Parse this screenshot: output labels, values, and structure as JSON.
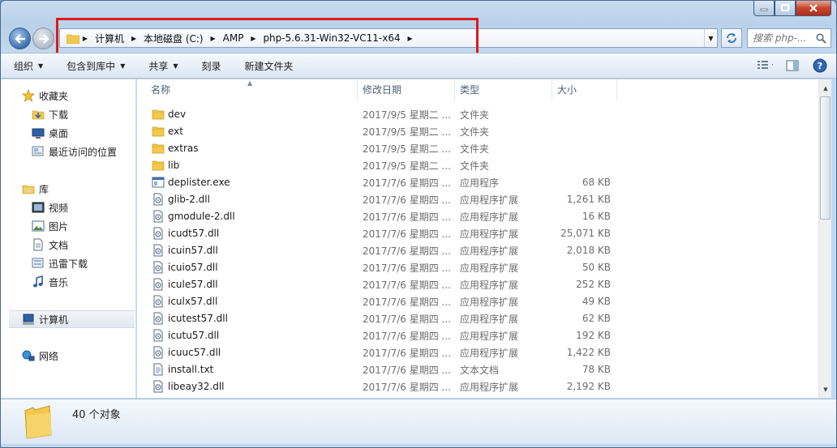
{
  "window": {
    "caption_buttons": [
      "minimize",
      "maximize",
      "close"
    ]
  },
  "address": {
    "breadcrumbs": [
      "计算机",
      "本地磁盘 (C:)",
      "AMP",
      "php-5.6.31-Win32-VC11-x64"
    ],
    "search_placeholder": "搜索 php-..."
  },
  "toolbar": {
    "organize": "组织",
    "include_in_library": "包含到库中",
    "share": "共享",
    "burn": "刻录",
    "new_folder": "新建文件夹"
  },
  "nav": {
    "favorites_label": "收藏夹",
    "favorites": [
      "下载",
      "桌面",
      "最近访问的位置"
    ],
    "libraries_label": "库",
    "libraries": [
      "视频",
      "图片",
      "文档",
      "迅雷下载",
      "音乐"
    ],
    "computer_label": "计算机",
    "network_label": "网络"
  },
  "columns": {
    "name": "名称",
    "date": "修改日期",
    "type": "类型",
    "size": "大小"
  },
  "files": [
    {
      "name": "dev",
      "date": "2017/9/5 星期二 ...",
      "type": "文件夹",
      "size": "",
      "icon": "folder-icon"
    },
    {
      "name": "ext",
      "date": "2017/9/5 星期二 ...",
      "type": "文件夹",
      "size": "",
      "icon": "folder-icon"
    },
    {
      "name": "extras",
      "date": "2017/9/5 星期二 ...",
      "type": "文件夹",
      "size": "",
      "icon": "folder-icon"
    },
    {
      "name": "lib",
      "date": "2017/9/5 星期二 ...",
      "type": "文件夹",
      "size": "",
      "icon": "folder-icon"
    },
    {
      "name": "deplister.exe",
      "date": "2017/7/6 星期四 ...",
      "type": "应用程序",
      "size": "68 KB",
      "icon": "exe-icon"
    },
    {
      "name": "glib-2.dll",
      "date": "2017/7/6 星期四 ...",
      "type": "应用程序扩展",
      "size": "1,261 KB",
      "icon": "dll-icon"
    },
    {
      "name": "gmodule-2.dll",
      "date": "2017/7/6 星期四 ...",
      "type": "应用程序扩展",
      "size": "16 KB",
      "icon": "dll-icon"
    },
    {
      "name": "icudt57.dll",
      "date": "2017/7/6 星期四 ...",
      "type": "应用程序扩展",
      "size": "25,071 KB",
      "icon": "dll-icon"
    },
    {
      "name": "icuin57.dll",
      "date": "2017/7/6 星期四 ...",
      "type": "应用程序扩展",
      "size": "2,018 KB",
      "icon": "dll-icon"
    },
    {
      "name": "icuio57.dll",
      "date": "2017/7/6 星期四 ...",
      "type": "应用程序扩展",
      "size": "50 KB",
      "icon": "dll-icon"
    },
    {
      "name": "icule57.dll",
      "date": "2017/7/6 星期四 ...",
      "type": "应用程序扩展",
      "size": "252 KB",
      "icon": "dll-icon"
    },
    {
      "name": "iculx57.dll",
      "date": "2017/7/6 星期四 ...",
      "type": "应用程序扩展",
      "size": "49 KB",
      "icon": "dll-icon"
    },
    {
      "name": "icutest57.dll",
      "date": "2017/7/6 星期四 ...",
      "type": "应用程序扩展",
      "size": "62 KB",
      "icon": "dll-icon"
    },
    {
      "name": "icutu57.dll",
      "date": "2017/7/6 星期四 ...",
      "type": "应用程序扩展",
      "size": "192 KB",
      "icon": "dll-icon"
    },
    {
      "name": "icuuc57.dll",
      "date": "2017/7/6 星期四 ...",
      "type": "应用程序扩展",
      "size": "1,422 KB",
      "icon": "dll-icon"
    },
    {
      "name": "install.txt",
      "date": "2017/7/6 星期四 ...",
      "type": "文本文档",
      "size": "78 KB",
      "icon": "text-file-icon"
    },
    {
      "name": "libeay32.dll",
      "date": "2017/7/6 星期四 ...",
      "type": "应用程序扩展",
      "size": "2,192 KB",
      "icon": "dll-icon"
    }
  ],
  "details": {
    "count": "40 个对象"
  },
  "colors": {
    "highlight_border": "#dd1b1b",
    "folder_yellow": "#f2c94c",
    "link_blue": "#1e4f8a"
  }
}
